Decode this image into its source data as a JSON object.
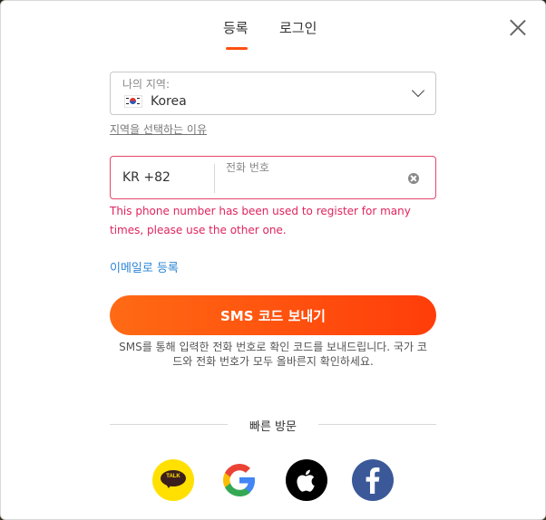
{
  "tabs": [
    {
      "label": "등록"
    },
    {
      "label": "로그인"
    }
  ],
  "region": {
    "label": "나의 지역:",
    "value": "Korea"
  },
  "why_region_link": "지역을 선택하는 이유",
  "phone": {
    "country_code": "KR +82",
    "label": "전화 번호",
    "value": ""
  },
  "error_message": "This phone number has been used to register for many times, please use the other one.",
  "email_register_link": "이메일로 등록",
  "sms_button_label": "SMS 코드 보내기",
  "sms_note": "SMS를 통해 입력한 전화 번호로 확인 코드를 보내드립니다. 국가 코드와 전화 번호가 모두 올바른지 확인하세요.",
  "quick_visit_label": "빠른 방문",
  "social": [
    {
      "name": "kakaotalk",
      "icon_text": "TALK",
      "color": "#ffe000"
    },
    {
      "name": "google",
      "color": "#ffffff"
    },
    {
      "name": "apple",
      "color": "#000000"
    },
    {
      "name": "facebook",
      "color": "#3b5998"
    }
  ],
  "colors": {
    "accent": "#ff4f12",
    "error": "#e0245e",
    "link": "#2b84d6"
  }
}
